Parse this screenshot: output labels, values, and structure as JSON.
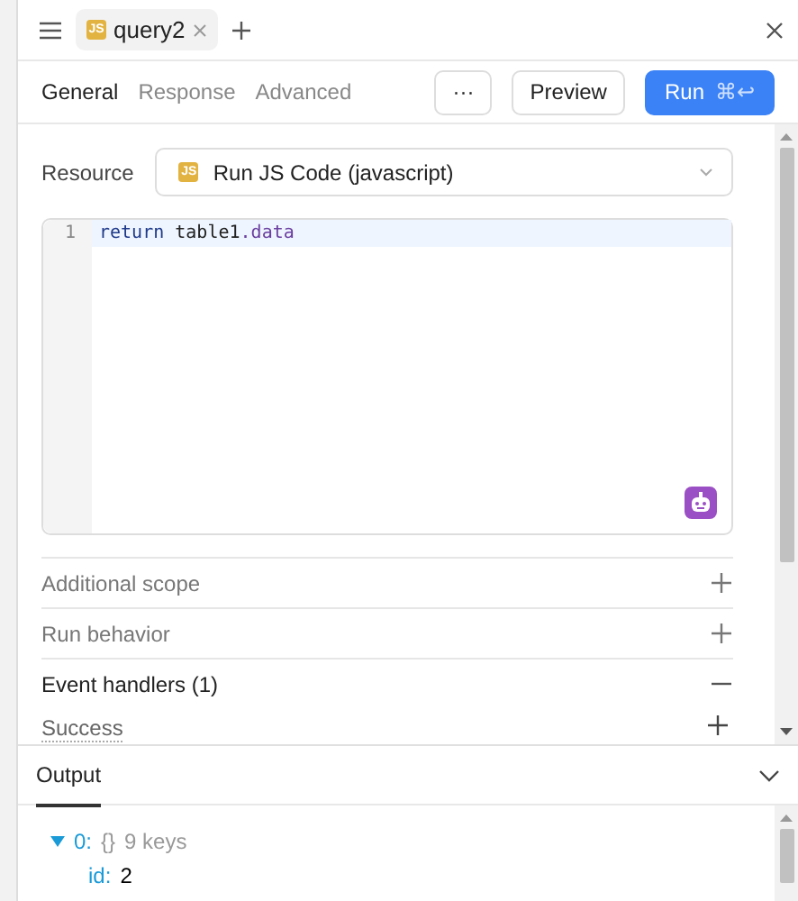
{
  "tab": {
    "badge": "JS",
    "title": "query2"
  },
  "subtabs": [
    {
      "label": "General",
      "selected": true
    },
    {
      "label": "Response",
      "selected": false
    },
    {
      "label": "Advanced",
      "selected": false
    }
  ],
  "actions": {
    "more": "···",
    "preview": "Preview",
    "run": "Run",
    "run_shortcut": "⌘↩"
  },
  "resource": {
    "label": "Resource",
    "badge": "JS",
    "value": "Run JS Code (javascript)"
  },
  "editor": {
    "lines": [
      {
        "number": "1",
        "tokens": [
          {
            "text": "return",
            "kind": "keyword"
          },
          {
            "text": " table1",
            "kind": "name"
          },
          {
            "text": ".data",
            "kind": "property"
          }
        ]
      }
    ]
  },
  "sections": [
    {
      "label": "Additional scope",
      "expanded": false
    },
    {
      "label": "Run behavior",
      "expanded": false
    },
    {
      "label": "Event handlers (1)",
      "expanded": true
    }
  ],
  "event_handlers": [
    {
      "label": "Success"
    }
  ],
  "output": {
    "title": "Output",
    "expanded": true,
    "tree": [
      {
        "key": "0:",
        "expanded": true,
        "type": "{}",
        "count": "9 keys",
        "children": [
          {
            "key": "id:",
            "value": "2"
          }
        ]
      }
    ]
  }
}
